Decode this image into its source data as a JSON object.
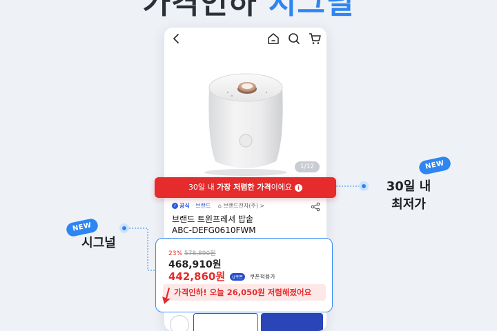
{
  "headline": {
    "part1": "가격인하",
    "part2": "시그널"
  },
  "nav": {
    "back_icon": "chevron-left-icon",
    "home_icon": "home-icon",
    "search_icon": "search-icon",
    "cart_icon": "cart-icon"
  },
  "product": {
    "image_counter": "1/12",
    "badge_official": "공식",
    "badge_brand": "브랜드",
    "store_name": "브랜드전자(주) >",
    "name": "브랜드 트윈프레셔 밥솥",
    "model": "ABC-DEFG0610FWM"
  },
  "banner": {
    "prefix": "30일 내 ",
    "highlight": "가장 저렴한 가격",
    "suffix": "이에요",
    "info_icon": "i"
  },
  "price": {
    "discount_percent": "23%",
    "original_price": "578,890원",
    "sale_price": "468,910원",
    "coupon_price": "442,860원",
    "coupon_badge": "U쿠폰",
    "coupon_label": "쿠폰적용가",
    "alert": "가격인하! 오늘 26,050원 저렴해졌어요"
  },
  "callouts": {
    "new_badge": "NEW",
    "right_label_line1": "30일 내",
    "right_label_line2": "최저가",
    "left_label": "시그널"
  },
  "colors": {
    "accent_blue": "#2d86f1",
    "alert_red": "#e52b2b",
    "brand_navy": "#2a45b8"
  }
}
